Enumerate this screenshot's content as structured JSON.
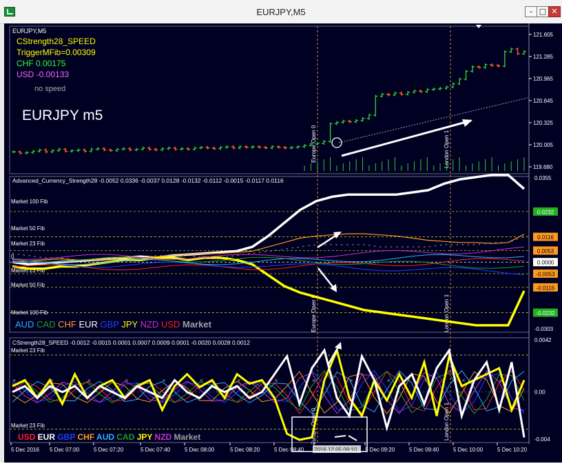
{
  "window": {
    "title": "EURJPY,M5",
    "min_label": "–",
    "restore_label": "□",
    "close_label": "✕"
  },
  "colors": {
    "background": "#000022",
    "grid": "#2a2a55",
    "axis_text": "#ffffff",
    "bull": "#33cc33",
    "bear": "#ff6a1a",
    "fib_line": "#c9c900",
    "session_line": "#e08a2a",
    "usd": "#ff2020",
    "eur": "#ffffff",
    "gbp": "#2040ff",
    "chf": "#ff9a20",
    "aud": "#30b0ff",
    "cad": "#20a020",
    "jpy": "#ffff00",
    "nzd": "#cc33cc",
    "market": "#a0a0a0"
  },
  "time_axis": {
    "labels": [
      "5 Dec 2016",
      "5 Dec 07:00",
      "5 Dec 07:20",
      "5 Dec 07:40",
      "5 Dec 08:00",
      "5 Dec 08:20",
      "5 Dec 08:40",
      "2016.12.05 09:10",
      "5 Dec 09:20",
      "5 Dec 09:40",
      "5 Dec 10:00",
      "5 Dec 10:20"
    ]
  },
  "panels": {
    "main": {
      "symbol_label": "EURJPY,M5",
      "indicator_lines": [
        {
          "text": "CStrength28_SPEED",
          "color": "#ffff00"
        },
        {
          "text": "TriggerMFib=0.00309",
          "color": "#ffff00"
        },
        {
          "text": "CHF 0.00175",
          "color": "#33ff33"
        },
        {
          "text": "USD -0.00133",
          "color": "#ff66ff"
        }
      ],
      "no_speed": "no speed",
      "big_label": "EURJPY m5",
      "price_labels": [
        "121.605",
        "121.285",
        "120.965",
        "120.645",
        "120.325",
        "120.005",
        "119.680"
      ],
      "session_labels": [
        "Europe Open 0",
        "London Open 1"
      ]
    },
    "strength": {
      "header": "Advanced_Currency_Strength28  -0.0052 0.0336 -0.0037 0.0128 -0.0132 -0.0112 -0.0015 -0.0117 0.0116",
      "fib_labels": [
        "Market 100 Fib",
        "Market 50 Fib",
        "Market 23 Fib",
        "0",
        "Market 23 Fib",
        "Market 50 Fib",
        "Market 100 Fib"
      ],
      "axis_labels": [
        "0.0355",
        "-0.0303"
      ],
      "value_boxes": [
        {
          "text": "0.0232",
          "bg": "#20b020",
          "fg": "#ffffff"
        },
        {
          "text": "0.0116",
          "bg": "#ff9a20",
          "fg": "#000000"
        },
        {
          "text": "0.0053",
          "bg": "#ff9a20",
          "fg": "#000000"
        },
        {
          "text": "0.0000",
          "bg": "#ffffff",
          "fg": "#000000"
        },
        {
          "text": "-0.0053",
          "bg": "#ff9a20",
          "fg": "#000000"
        },
        {
          "text": "-0.0116",
          "bg": "#ff9a20",
          "fg": "#000000"
        },
        {
          "text": "-0.0232",
          "bg": "#20b020",
          "fg": "#ffffff"
        }
      ],
      "session_labels": [
        "Europe Open 0",
        "London Open 1"
      ],
      "legend": [
        {
          "text": "AUD",
          "color": "#30b0ff"
        },
        {
          "text": "CAD",
          "color": "#20a020"
        },
        {
          "text": "CHF",
          "color": "#ff9a20"
        },
        {
          "text": "EUR",
          "color": "#ffffff"
        },
        {
          "text": "GBP",
          "color": "#2040ff"
        },
        {
          "text": "JPY",
          "color": "#ffff00"
        },
        {
          "text": "NZD",
          "color": "#cc33cc"
        },
        {
          "text": "USD",
          "color": "#ff2020"
        },
        {
          "text": "Market",
          "color": "#a0a0a0"
        }
      ]
    },
    "speed": {
      "header": "CStrength28_SPEED  -0.0012 -0.0015 0.0001 0.0007 0.0009 0.0001 -0.0020 0.0028 0.0012",
      "fib_labels": [
        "Market 23 Fib",
        "Market 23 Fib"
      ],
      "axis_labels": [
        "0.0042",
        "0.00",
        "-0.004"
      ],
      "session_labels": [
        "Europe Open 0",
        "London Open 1"
      ],
      "legend": [
        {
          "text": "USD",
          "color": "#ff2020"
        },
        {
          "text": "EUR",
          "color": "#ffffff"
        },
        {
          "text": "GBP",
          "color": "#2040ff"
        },
        {
          "text": "CHF",
          "color": "#ff9a20"
        },
        {
          "text": "AUD",
          "color": "#30b0ff"
        },
        {
          "text": "CAD",
          "color": "#20a020"
        },
        {
          "text": "JPY",
          "color": "#ffff00"
        },
        {
          "text": "NZD",
          "color": "#cc33cc"
        },
        {
          "text": "Market",
          "color": "#a0a0a0"
        }
      ]
    }
  },
  "chart_data": [
    {
      "type": "line",
      "title": "EURJPY,M5",
      "xlabel": "",
      "ylabel": "",
      "ylim": [
        119.68,
        121.7
      ],
      "series": [
        {
          "name": "EURJPY",
          "values": [
            119.95,
            119.93,
            119.94,
            119.96,
            119.98,
            119.95,
            119.97,
            119.99,
            119.96,
            119.97,
            119.98,
            119.96,
            119.99,
            120.0,
            119.98,
            119.97,
            119.99,
            120.0,
            119.98,
            119.99,
            120.01,
            119.99,
            119.98,
            120.0,
            120.01,
            119.99,
            120.0,
            119.99,
            120.01,
            120.02,
            120.01,
            120.0,
            120.02,
            120.03,
            120.01,
            120.03,
            120.02,
            120.03,
            120.02,
            120.01,
            120.03,
            120.02,
            120.01,
            120.02,
            120.03,
            120.05,
            120.07,
            120.08,
            120.11,
            120.38,
            120.4,
            120.42,
            120.41,
            120.43,
            120.46,
            120.51,
            120.8,
            120.83,
            120.82,
            120.85,
            120.83,
            120.86,
            120.88,
            120.87,
            120.9,
            120.91,
            120.92,
            120.94,
            120.99,
            121.06,
            121.18,
            121.25,
            121.24,
            121.28,
            121.27,
            121.26,
            121.48,
            121.52,
            121.45,
            121.48
          ]
        }
      ]
    },
    {
      "type": "line",
      "title": "Advanced_Currency_Strength28",
      "xlabel": "",
      "ylabel": "",
      "ylim": [
        -0.0303,
        0.0355
      ],
      "series": [
        {
          "name": "EUR",
          "values": [
            0.0,
            -0.001,
            -0.0005,
            0.0,
            0.0005,
            0.001,
            0.0015,
            0.002,
            0.0025,
            0.002,
            0.003,
            0.0035,
            0.004,
            0.0045,
            0.005,
            0.007,
            0.012,
            0.018,
            0.024,
            0.028,
            0.03,
            0.031,
            0.031,
            0.031,
            0.031,
            0.032,
            0.033,
            0.036,
            0.038,
            0.039,
            0.04,
            0.04,
            0.0336
          ]
        },
        {
          "name": "JPY",
          "values": [
            -0.002,
            -0.003,
            -0.003,
            -0.002,
            -0.002,
            -0.001,
            0.0,
            0.001,
            0.001,
            0.002,
            0.002,
            0.001,
            0.002,
            0.002,
            0.001,
            -0.001,
            -0.006,
            -0.011,
            -0.014,
            -0.016,
            -0.018,
            -0.02,
            -0.022,
            -0.023,
            -0.024,
            -0.025,
            -0.026,
            -0.027,
            -0.028,
            -0.029,
            -0.029,
            -0.029,
            -0.0132
          ]
        },
        {
          "name": "CHF",
          "values": [
            0.0,
            0.0005,
            0.001,
            0.0015,
            0.001,
            0.001,
            0.0015,
            0.002,
            0.002,
            0.0025,
            0.003,
            0.0035,
            0.004,
            0.004,
            0.0045,
            0.005,
            0.007,
            0.009,
            0.011,
            0.012,
            0.0125,
            0.013,
            0.013,
            0.0125,
            0.012,
            0.011,
            0.01,
            0.0095,
            0.009,
            0.009,
            0.0085,
            0.009,
            0.0128
          ]
        },
        {
          "name": "Market",
          "values": [
            0.004,
            0.003,
            0.002,
            0.002,
            0.001,
            0.001,
            0.002,
            0.002,
            0.002,
            0.003,
            0.003,
            0.003,
            0.002,
            0.002,
            0.003,
            0.004,
            0.005,
            0.006,
            0.007,
            0.008,
            0.008,
            0.008,
            0.008,
            0.007,
            0.007,
            0.007,
            0.007,
            0.008,
            0.008,
            0.008,
            0.009,
            0.009,
            0.0116
          ]
        }
      ]
    },
    {
      "type": "line",
      "title": "CStrength28_SPEED",
      "xlabel": "",
      "ylabel": "",
      "ylim": [
        -0.004,
        0.0042
      ],
      "series": [
        {
          "name": "JPY",
          "values": [
            0.0005,
            0.001,
            -0.0005,
            0.001,
            -0.001,
            0.0015,
            -0.0005,
            0.0005,
            0.001,
            -0.0005,
            0.0005,
            0.001,
            -0.0015,
            0.0005,
            0.0015,
            0.0004,
            0.001,
            -0.0005,
            0.0015,
            0.0007,
            0.001,
            -0.0005,
            -0.0035,
            -0.004,
            -0.0038,
            0.001,
            0.0035,
            -0.0005,
            -0.002,
            0.001,
            -0.0007,
            0.0015,
            -0.0005,
            0.0025,
            -0.002,
            0.003,
            0.0005,
            0.001,
            0.0015,
            0.002,
            -0.0015,
            0.001
          ]
        },
        {
          "name": "EUR",
          "values": [
            0.0,
            0.0005,
            -0.0005,
            0.0005,
            0.0,
            0.0005,
            -0.0005,
            0.0005,
            0.0,
            -0.0005,
            0.0005,
            0.0,
            -0.0005,
            0.001,
            0.0,
            -0.0005,
            0.0005,
            0.0,
            0.0005,
            -0.0005,
            0.0,
            0.0015,
            0.003,
            -0.001,
            0.002,
            0.0035,
            -0.0005,
            -0.002,
            0.003,
            0.001,
            -0.003,
            0.0005,
            0.0015,
            -0.001,
            0.002,
            0.0035,
            -0.002,
            0.001,
            0.0025,
            -0.0015,
            0.0025,
            -0.0038
          ]
        }
      ]
    }
  ]
}
